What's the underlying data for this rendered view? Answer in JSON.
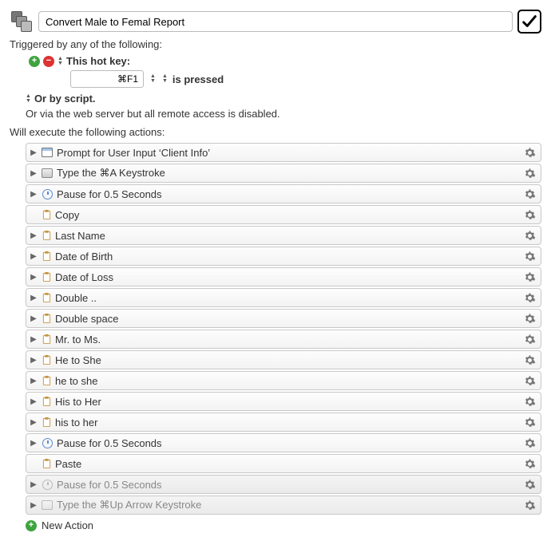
{
  "header": {
    "title_value": "Convert Male to Femal Report",
    "enabled": true
  },
  "triggers": {
    "section_label": "Triggered by any of the following:",
    "hotkey_label": "This hot key:",
    "hotkey_value": "⌘F1",
    "pressed_label": "is pressed",
    "script_label": "Or by script.",
    "webserver_label": "Or via the web server but all remote access is disabled."
  },
  "actions": {
    "section_label": "Will execute the following actions:",
    "items": [
      {
        "label": "Prompt for User Input ‘Client Info’",
        "icon": "window",
        "disclose": true,
        "dim": false
      },
      {
        "label": "Type the ⌘A Keystroke",
        "icon": "key",
        "disclose": true,
        "dim": false
      },
      {
        "label": "Pause for 0.5 Seconds",
        "icon": "clock",
        "disclose": true,
        "dim": false
      },
      {
        "label": "Copy",
        "icon": "clip",
        "disclose": false,
        "dim": false
      },
      {
        "label": "Last Name",
        "icon": "clip",
        "disclose": true,
        "dim": false
      },
      {
        "label": "Date of Birth",
        "icon": "clip",
        "disclose": true,
        "dim": false
      },
      {
        "label": "Date of Loss",
        "icon": "clip",
        "disclose": true,
        "dim": false
      },
      {
        "label": "Double ..",
        "icon": "clip",
        "disclose": true,
        "dim": false
      },
      {
        "label": "Double space",
        "icon": "clip",
        "disclose": true,
        "dim": false
      },
      {
        "label": "Mr. to Ms.",
        "icon": "clip",
        "disclose": true,
        "dim": false
      },
      {
        "label": "He to She",
        "icon": "clip",
        "disclose": true,
        "dim": false
      },
      {
        "label": "he to she",
        "icon": "clip",
        "disclose": true,
        "dim": false
      },
      {
        "label": "His to Her",
        "icon": "clip",
        "disclose": true,
        "dim": false
      },
      {
        "label": "his to her",
        "icon": "clip",
        "disclose": true,
        "dim": false
      },
      {
        "label": "Pause for 0.5 Seconds",
        "icon": "clock",
        "disclose": true,
        "dim": false
      },
      {
        "label": "Paste",
        "icon": "clip",
        "disclose": false,
        "dim": false
      },
      {
        "label": "Pause for 0.5 Seconds",
        "icon": "clock",
        "disclose": true,
        "dim": true
      },
      {
        "label": "Type the ⌘Up Arrow Keystroke",
        "icon": "key",
        "disclose": true,
        "dim": true
      }
    ],
    "new_action_label": "New Action"
  }
}
